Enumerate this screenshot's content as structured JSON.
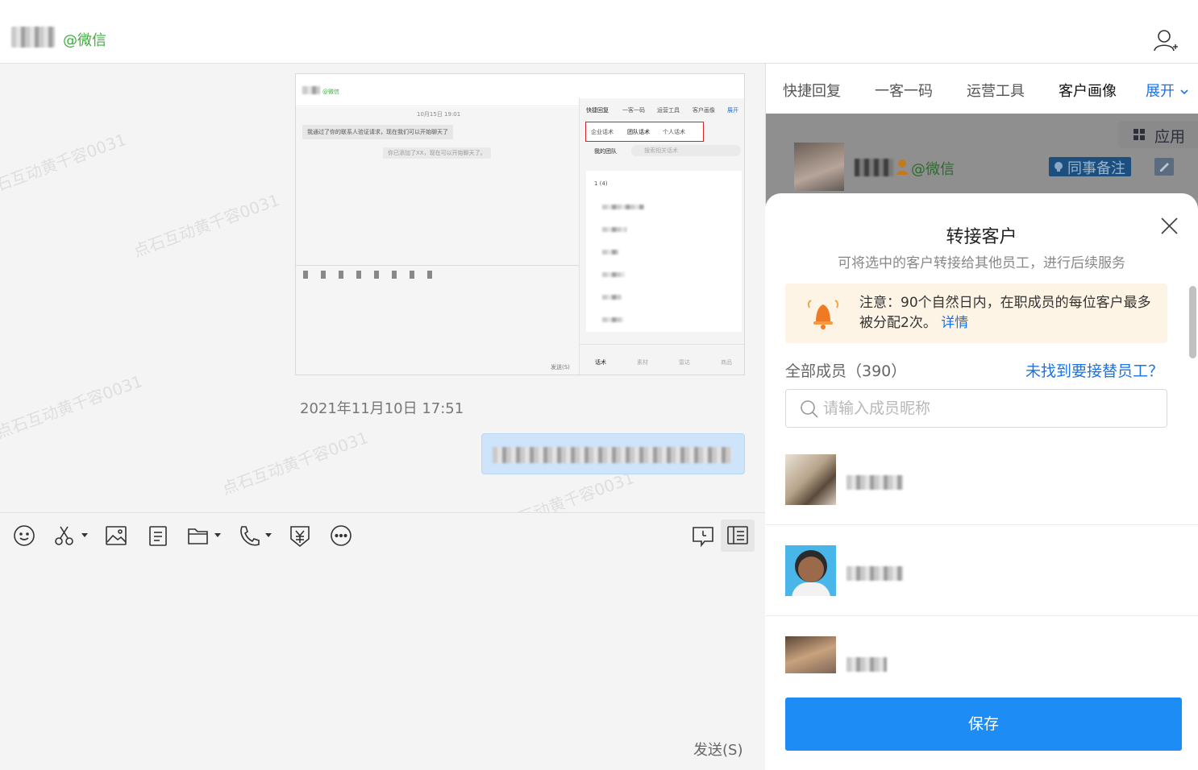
{
  "header": {
    "contact_suffix": "@微信"
  },
  "chat": {
    "watermark": "点石互动黄千容0031",
    "date_stamp": "2021年11月10日 17:51",
    "embedded_screenshot": {
      "contact_suffix": "@微信",
      "time": "10月15日 19:01",
      "message": "我通过了你的联系人验证请求，现在我们可以开始聊天了",
      "system_note": "你已添加了XX，现在可以开始聊天了。",
      "tabs": [
        "快捷回复",
        "一客一码",
        "运营工具",
        "客户画像",
        "展开"
      ],
      "subtabs": [
        "企业话术",
        "团队话术",
        "个人话术"
      ],
      "team_filter": "我的团队",
      "search_placeholder": "搜索相关话术",
      "first_item": "1 (4)",
      "send": "发送(S)",
      "bottom_nav": [
        "话术",
        "素材",
        "雷达",
        "商品"
      ]
    }
  },
  "toolbar": {
    "icons": [
      "emoji-icon",
      "scissors-icon",
      "image-icon",
      "document-icon",
      "folder-icon",
      "phone-icon",
      "red-packet-icon",
      "more-icon",
      "chat-history-icon",
      "sidebar-icon"
    ]
  },
  "compose": {
    "send_label": "发送(S)"
  },
  "right_panel": {
    "tabs": [
      "快捷回复",
      "一客一码",
      "运营工具",
      "客户画像"
    ],
    "expand_label": "展开",
    "apps_label": "应用",
    "customer_suffix": "@微信",
    "colleague_note": "同事备注"
  },
  "modal": {
    "title": "转接客户",
    "subtitle": "可将选中的客户转接给其他员工，进行后续服务",
    "notice_text": "注意：90个自然日内，在职成员的每位客户最多被分配2次。",
    "notice_link": "详情",
    "members_title": "全部成员（390）",
    "not_found_link": "未找到要接替员工？",
    "search_placeholder": "请输入成员昵称",
    "save_label": "保存"
  },
  "colors": {
    "accent": "#1e8cf5",
    "wechat_green": "#3fae3f",
    "link_blue": "#1a73e8",
    "notice_bg": "#fdf4e6"
  }
}
